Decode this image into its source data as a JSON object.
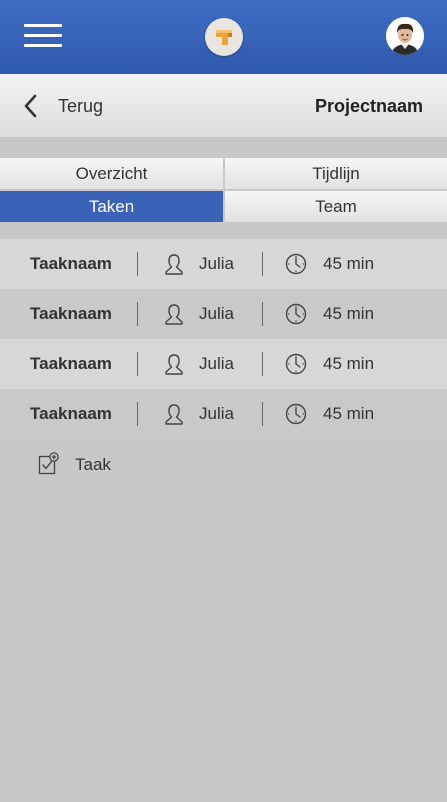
{
  "header": {
    "menu_icon": "hamburger-menu-icon",
    "logo_icon": "app-logo",
    "avatar_icon": "user-avatar",
    "brand_color": "#3a63b8"
  },
  "subheader": {
    "back_label": "Terug",
    "project_name": "Projectnaam"
  },
  "tabs": [
    {
      "label": "Overzicht",
      "active": false
    },
    {
      "label": "Tijdlijn",
      "active": false
    },
    {
      "label": "Taken",
      "active": true
    },
    {
      "label": "Team",
      "active": false
    }
  ],
  "tasks": [
    {
      "name": "Taaknaam",
      "assignee": "Julia",
      "duration": "45 min"
    },
    {
      "name": "Taaknaam",
      "assignee": "Julia",
      "duration": "45 min"
    },
    {
      "name": "Taaknaam",
      "assignee": "Julia",
      "duration": "45 min"
    },
    {
      "name": "Taaknaam",
      "assignee": "Julia",
      "duration": "45 min"
    }
  ],
  "add_task": {
    "label": "Taak",
    "icon": "add-task-icon"
  }
}
